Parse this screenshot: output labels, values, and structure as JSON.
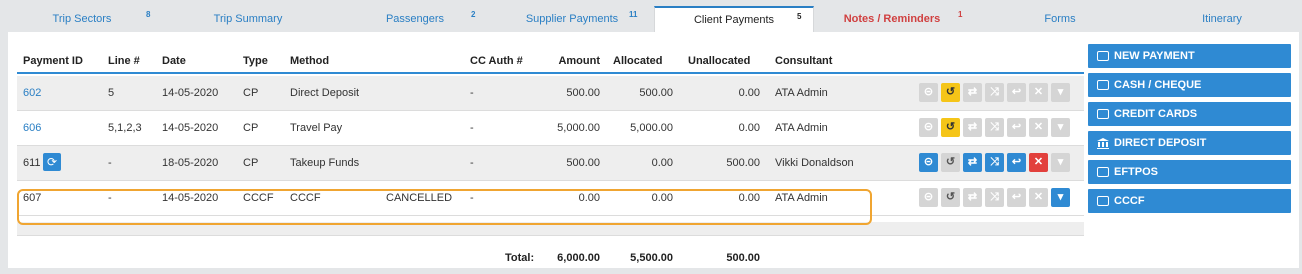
{
  "tabs": [
    {
      "label": "Trip Sectors",
      "badge": "8"
    },
    {
      "label": "Trip Summary",
      "badge": ""
    },
    {
      "label": "Passengers",
      "badge": "2"
    },
    {
      "label": "Supplier Payments",
      "badge": "11"
    },
    {
      "label": "Client Payments",
      "badge": "5"
    },
    {
      "label": "Notes / Reminders",
      "badge": "1"
    },
    {
      "label": "Forms",
      "badge": ""
    },
    {
      "label": "Itinerary",
      "badge": ""
    }
  ],
  "table": {
    "headers": {
      "payment_id": "Payment ID",
      "line": "Line #",
      "date": "Date",
      "type": "Type",
      "method": "Method",
      "cc_auth": "CC Auth #",
      "amount": "Amount",
      "allocated": "Allocated",
      "unallocated": "Unallocated",
      "consultant": "Consultant"
    },
    "rows": [
      {
        "payment_id": "602",
        "line": "5",
        "date": "14-05-2020",
        "type": "CP",
        "method": "Direct Deposit",
        "status": "",
        "cc_auth": "-",
        "amount": "500.00",
        "allocated": "500.00",
        "unallocated": "0.00",
        "consultant": "ATA Admin"
      },
      {
        "payment_id": "606",
        "line": "5,1,2,3",
        "date": "14-05-2020",
        "type": "CP",
        "method": "Travel Pay",
        "status": "",
        "cc_auth": "-",
        "amount": "5,000.00",
        "allocated": "5,000.00",
        "unallocated": "0.00",
        "consultant": "ATA Admin"
      },
      {
        "payment_id": "611",
        "line": "-",
        "date": "18-05-2020",
        "type": "CP",
        "method": "Takeup Funds",
        "status": "",
        "cc_auth": "-",
        "amount": "500.00",
        "allocated": "0.00",
        "unallocated": "500.00",
        "consultant": "Vikki Donaldson"
      },
      {
        "payment_id": "607",
        "line": "-",
        "date": "14-05-2020",
        "type": "CCCF",
        "method": "CCCF",
        "status": "CANCELLED",
        "cc_auth": "-",
        "amount": "0.00",
        "allocated": "0.00",
        "unallocated": "0.00",
        "consultant": "ATA Admin"
      }
    ],
    "totals": {
      "label": "Total:",
      "amount": "6,000.00",
      "allocated": "5,500.00",
      "unallocated": "500.00"
    }
  },
  "side_buttons": [
    {
      "label": "NEW PAYMENT",
      "icon": "money-icon"
    },
    {
      "label": "CASH / CHEQUE",
      "icon": "money-icon"
    },
    {
      "label": "CREDIT CARDS",
      "icon": "credit-card-icon"
    },
    {
      "label": "DIRECT DEPOSIT",
      "icon": "bank-icon"
    },
    {
      "label": "EFTPOS",
      "icon": "money-icon"
    },
    {
      "label": "CCCF",
      "icon": "money-icon"
    }
  ],
  "colors": {
    "accent": "#2f8ad3",
    "highlight": "#f0a531",
    "warning": "#f5c518",
    "danger": "#e2403c"
  }
}
